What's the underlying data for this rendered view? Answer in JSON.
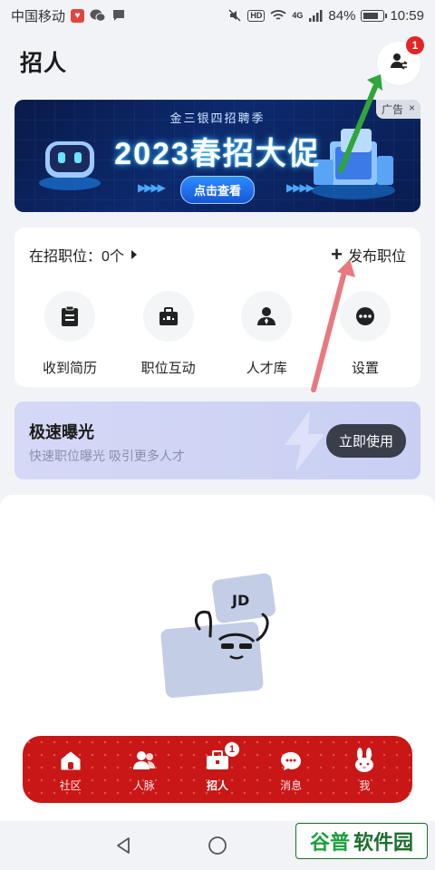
{
  "status_bar": {
    "carrier": "中国移动",
    "battery": "84%",
    "battery_level": 0.84,
    "time": "10:59",
    "network": "4G",
    "hd_label": "HD",
    "icons": [
      "app-badge-icon",
      "wechat-icon",
      "message-icon",
      "mute-icon",
      "wifi-icon",
      "signal-icon",
      "battery-icon"
    ]
  },
  "header": {
    "title": "招人",
    "switch_badge": "1",
    "switch_icon": "switch-identity-icon"
  },
  "banner": {
    "subtitle": "金三银四招聘季",
    "headline": "2023春招大促",
    "cta": "点击查看",
    "ad_label": "广告",
    "close_symbol": "×"
  },
  "jobs": {
    "count_text": "在招职位：0个",
    "post_label": "发布职位",
    "plus_symbol": "+",
    "actions": [
      {
        "label": "收到简历",
        "icon": "resume-icon"
      },
      {
        "label": "职位互动",
        "icon": "briefcase-icon"
      },
      {
        "label": "人才库",
        "icon": "talent-icon"
      },
      {
        "label": "设置",
        "icon": "more-icon"
      }
    ]
  },
  "boost": {
    "title": "极速曝光",
    "desc": "快速职位曝光 吸引更多人才",
    "button": "立即使用"
  },
  "illustration": {
    "card_text": "JD"
  },
  "bottom_nav": {
    "items": [
      {
        "label": "社区",
        "icon": "house-icon"
      },
      {
        "label": "人脉",
        "icon": "contacts-icon"
      },
      {
        "label": "招人",
        "icon": "recruit-icon",
        "badge": "1"
      },
      {
        "label": "消息",
        "icon": "chat-icon"
      },
      {
        "label": "我",
        "icon": "rabbit-icon"
      }
    ],
    "active_index": 2
  },
  "watermark": {
    "text_a": "谷普",
    "text_b": "软件园"
  },
  "colors": {
    "nav_red": "#c91616",
    "badge_red": "#e52525",
    "banner_blue": "#0d2a6e",
    "boost_bg": "#d5d9f6",
    "boost_button": "#3a3d4a",
    "annotation_green": "#2fa53a",
    "annotation_pink": "#e8797f"
  }
}
